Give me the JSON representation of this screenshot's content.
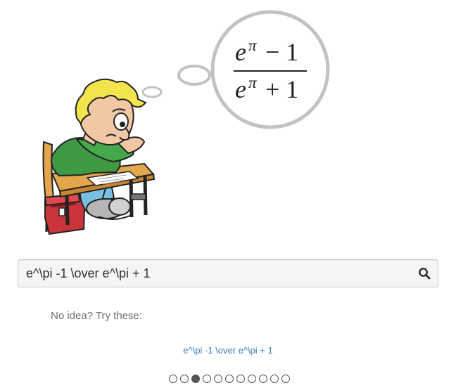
{
  "thought": {
    "numerator_base": "e",
    "numerator_exp": "π",
    "numerator_rest": "− 1",
    "denominator_base": "e",
    "denominator_exp": "π",
    "denominator_rest": "+ 1"
  },
  "search": {
    "value": "e^\\pi -1 \\over e^\\pi + 1",
    "icon": "search-icon"
  },
  "hint": "No idea? Try these:",
  "suggestions": [
    "e^\\pi -1 \\over e^\\pi + 1"
  ],
  "pager": {
    "count": 11,
    "active": 3
  },
  "colors": {
    "link": "#337ab7",
    "bubble": "#c2c2c2",
    "shirt": "#3f9a43",
    "hair": "#f1e44d",
    "desk": "#e3a64d"
  }
}
